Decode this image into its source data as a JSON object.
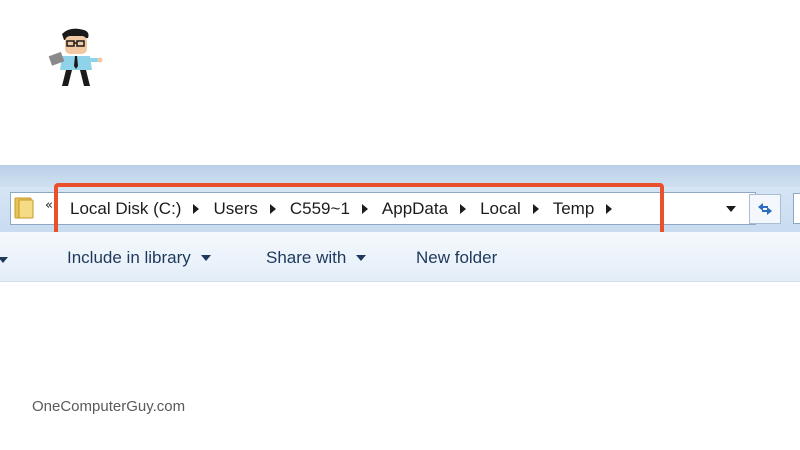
{
  "logo": {
    "alt": "OneComputerGuy mascot"
  },
  "address_bar": {
    "folder_icon": "folder-icon",
    "back_chevron": "«",
    "breadcrumbs": [
      "Local Disk (C:)",
      "Users",
      "C559~1",
      "AppData",
      "Local",
      "Temp"
    ],
    "highlight_color": "#e8512b"
  },
  "toolbar": {
    "items": [
      {
        "label": "Include in library",
        "has_dropdown": true
      },
      {
        "label": "Share with",
        "has_dropdown": true
      },
      {
        "label": "New folder",
        "has_dropdown": false
      }
    ]
  },
  "watermark": "OneComputerGuy.com"
}
